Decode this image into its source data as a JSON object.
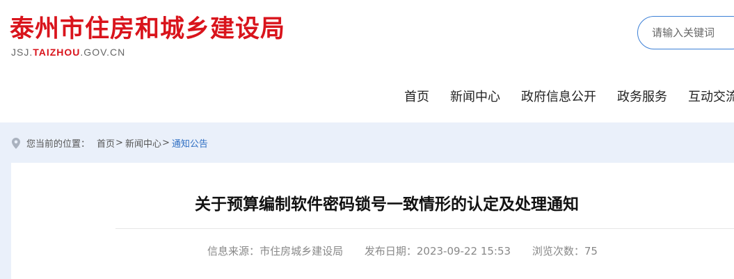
{
  "site": {
    "title": "泰州市住房和城乡建设局",
    "domain_prefix": "JSJ.",
    "domain_highlight": "TAIZHOU",
    "domain_suffix": ".GOV.CN"
  },
  "search": {
    "placeholder": "请输入关键词"
  },
  "nav": {
    "items": [
      "首页",
      "新闻中心",
      "政府信息公开",
      "政务服务",
      "互动交流"
    ]
  },
  "breadcrumb": {
    "prefix": "您当前的位置：",
    "items": [
      "首页",
      "新闻中心",
      "通知公告"
    ],
    "separator": ">"
  },
  "article": {
    "title": "关于预算编制软件密码锁号一致情形的认定及处理通知",
    "source_label": "信息来源：",
    "source": "市住房城乡建设局",
    "date_label": "发布日期：",
    "date": "2023-09-22 15:53",
    "views_label": "浏览次数：",
    "views": "75"
  },
  "colors": {
    "brand_red": "#d9141c",
    "accent_blue": "#2f6fc3",
    "crumb_bg": "#eaf0fa"
  },
  "icons": {
    "location": "location-pin-icon"
  }
}
